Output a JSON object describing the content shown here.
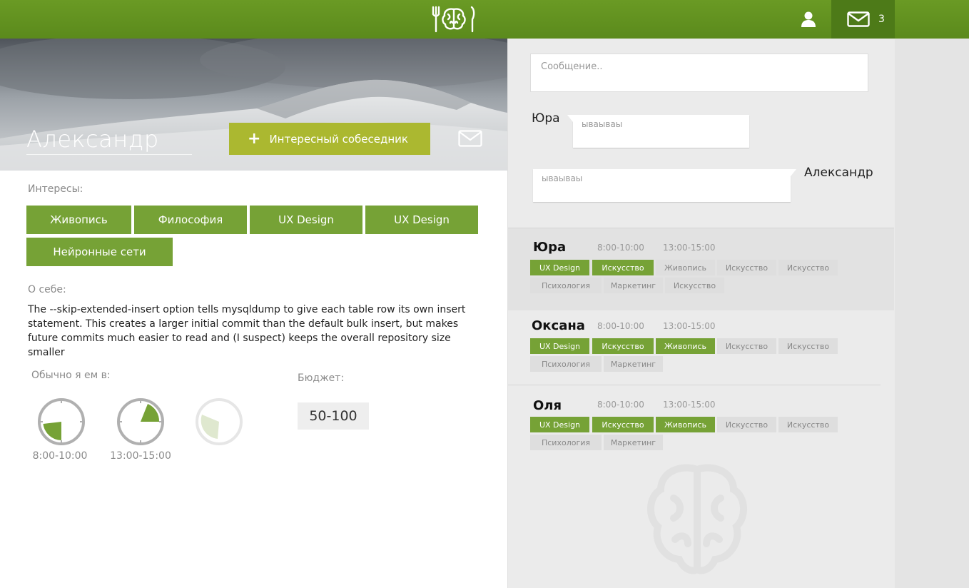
{
  "header": {
    "logo_icon": "fork-brain-knife-logo",
    "user_icon": "user-icon",
    "mail_icon": "envelope-icon",
    "mail_count": "3",
    "accent_color": "#5e8e1f"
  },
  "profile": {
    "name": "Александр",
    "add_button_label": "Интересный собеседник",
    "interests_label": "Интересы:",
    "interests": [
      "Живопись",
      "Философия",
      "UX Design",
      "UX Design",
      "Нейронные сети"
    ],
    "about_label": "О себе:",
    "about_text": "The --skip-extended-insert option tells mysqldump to give each table row its own insert statement. This creates a larger initial commit than the default bulk insert, but makes future commits much easier to read and (I suspect) keeps the overall repository size smaller",
    "eat_label": "Обычно я ем в:",
    "eat_times": [
      "8:00-10:00",
      "13:00-15:00"
    ],
    "budget_label": "Бюджет:",
    "budget_value": "50-100"
  },
  "chat": {
    "input_placeholder": "Сообщение..",
    "messages": [
      {
        "author": "Юра",
        "text": "ываываы"
      },
      {
        "author": "Александр",
        "text": "ываываы"
      }
    ]
  },
  "people": [
    {
      "name": "Юра",
      "times": [
        "8:00-10:00",
        "13:00-15:00"
      ],
      "tags_row1": [
        {
          "label": "UX Design",
          "active": true
        },
        {
          "label": "Искусство",
          "active": true
        },
        {
          "label": "Живопись",
          "active": false
        },
        {
          "label": "Искусство",
          "active": false
        },
        {
          "label": "Искусство",
          "active": false
        }
      ],
      "tags_row2": [
        {
          "label": "Психология",
          "active": false
        },
        {
          "label": "Маркетинг",
          "active": false
        },
        {
          "label": "Искусство",
          "active": false
        }
      ]
    },
    {
      "name": "Оксана",
      "times": [
        "8:00-10:00",
        "13:00-15:00"
      ],
      "tags_row1": [
        {
          "label": "UX Design",
          "active": true
        },
        {
          "label": "Искусство",
          "active": true
        },
        {
          "label": "Живопись",
          "active": true
        },
        {
          "label": "Искусство",
          "active": false
        },
        {
          "label": "Искусство",
          "active": false
        }
      ],
      "tags_row2": [
        {
          "label": "Психология",
          "active": false
        },
        {
          "label": "Маркетинг",
          "active": false
        }
      ]
    },
    {
      "name": "Оля",
      "times": [
        "8:00-10:00",
        "13:00-15:00"
      ],
      "tags_row1": [
        {
          "label": "UX Design",
          "active": true
        },
        {
          "label": "Искусство",
          "active": true
        },
        {
          "label": "Живопись",
          "active": true
        },
        {
          "label": "Искусство",
          "active": false
        },
        {
          "label": "Искусство",
          "active": false
        }
      ],
      "tags_row2": [
        {
          "label": "Психология",
          "active": false
        },
        {
          "label": "Маркетинг",
          "active": false
        }
      ]
    }
  ]
}
